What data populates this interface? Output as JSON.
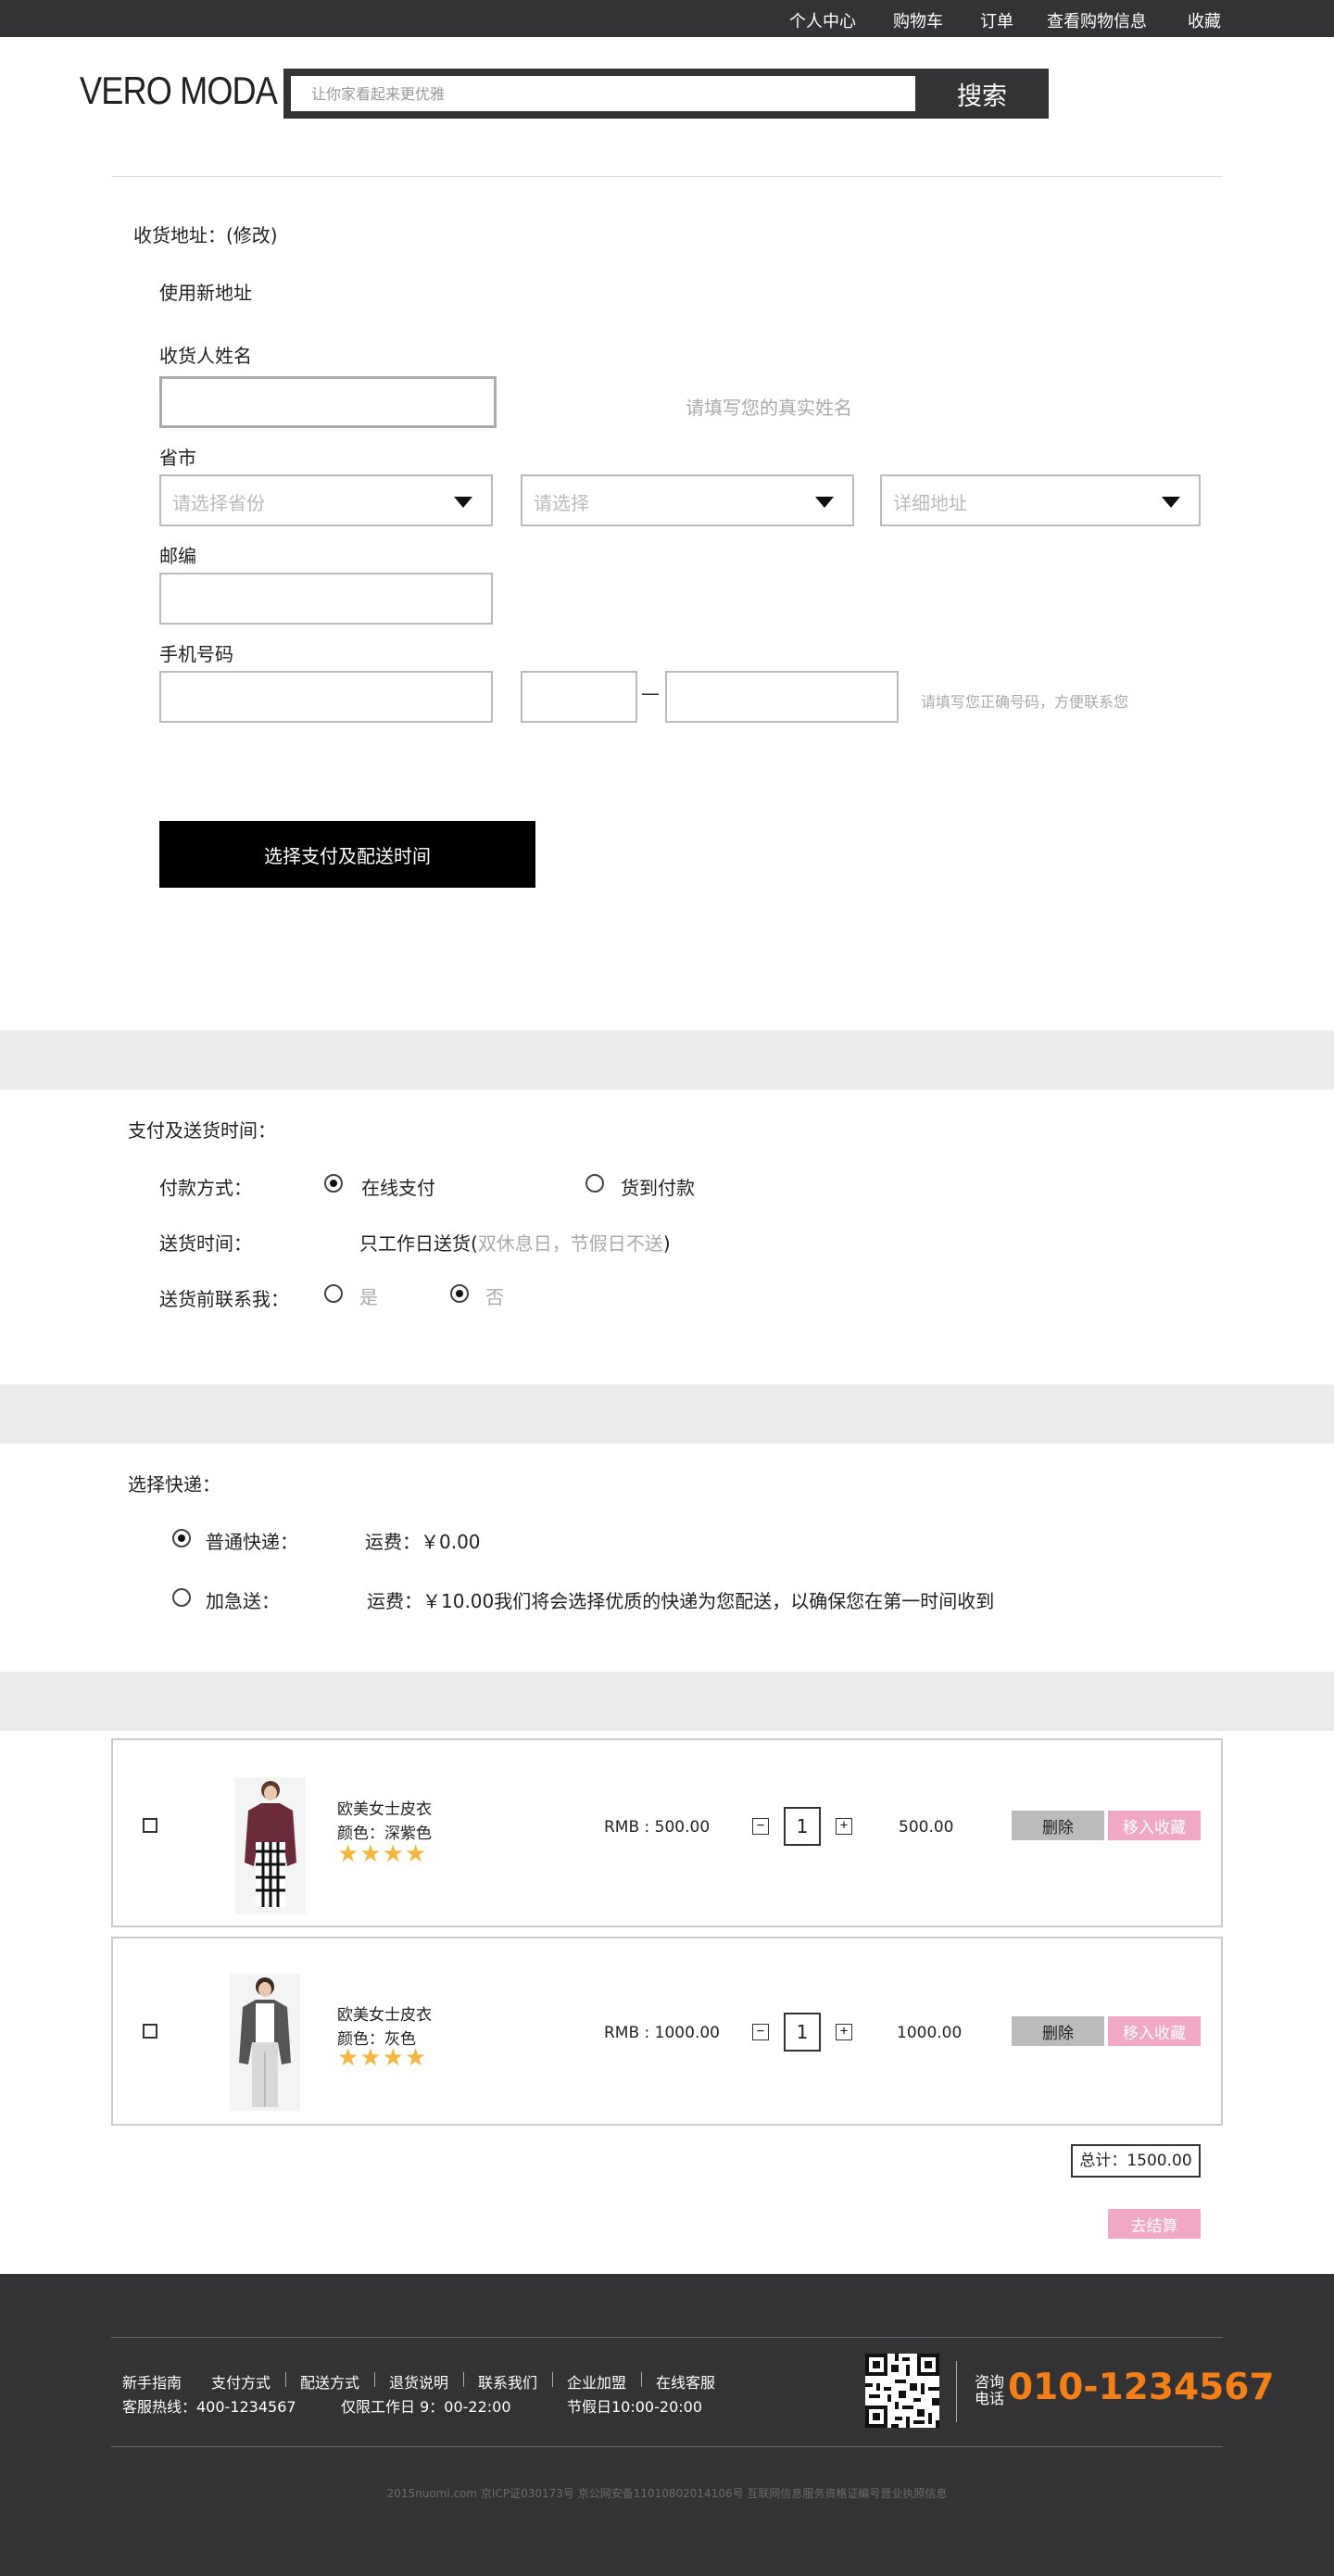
{
  "topnav": {
    "items": [
      "个人中心",
      "购物车",
      "订单",
      "查看购物信息",
      "收藏"
    ]
  },
  "header": {
    "logo": "VERO MODA",
    "search_placeholder": "让你家看起来更优雅",
    "search_button": "搜索"
  },
  "address": {
    "title": "收货地址：(修改)",
    "use_new": "使用新地址",
    "name_label": "收货人姓名",
    "name_hint": "请填写您的真实姓名",
    "province_label": "省市",
    "province_placeholder": "请选择省份",
    "city_placeholder": "请选择",
    "detail_placeholder": "详细地址",
    "zip_label": "邮编",
    "phone_label": "手机号码",
    "phone_dash": "—",
    "phone_hint": "请填写您正确号码，方便联系您",
    "submit": "选择支付及配送时间"
  },
  "payment": {
    "title": "支付及送货时间：",
    "method_label": "付款方式：",
    "online": "在线支付",
    "cod": "货到付款",
    "method_selected": "在线支付",
    "time_label": "送货时间：",
    "time_value": "只工作日送货",
    "time_paren_open": "(",
    "time_note": "双休息日，节假日不送",
    "time_paren_close": ")",
    "contact_label": "送货前联系我：",
    "yes": "是",
    "no": "否",
    "contact_selected": "否"
  },
  "shipping": {
    "title": "选择快递：",
    "options": [
      {
        "name": "普通快递：",
        "fee": "运费：￥0.00",
        "selected": true
      },
      {
        "name": "加急送：",
        "fee": "运费：￥10.00我们将会选择优质的快递为您配送，以确保您在第一时间收到",
        "selected": false
      }
    ]
  },
  "cart": {
    "items": [
      {
        "name": "欧美女士皮衣",
        "color": "颜色：深紫色",
        "stars": "★★★★",
        "rating": 4,
        "price": "RMB : 500.00",
        "qty": "1",
        "subtotal": "500.00",
        "delete": "删除",
        "favorite": "移入收藏",
        "jacket_color": "#6b2c3a"
      },
      {
        "name": "欧美女士皮衣",
        "color": "颜色：灰色",
        "stars": "★★★★",
        "rating": 4,
        "price": "RMB : 1000.00",
        "qty": "1",
        "subtotal": "1000.00",
        "delete": "删除",
        "favorite": "移入收藏",
        "jacket_color": "#555555"
      }
    ],
    "minus": "−",
    "plus": "+",
    "total": "总计：1500.00",
    "checkout": "去结算"
  },
  "footer": {
    "links": [
      "新手指南",
      "支付方式",
      "配送方式",
      "退货说明",
      "联系我们",
      "企业加盟",
      "在线客服"
    ],
    "hotline": "客服热线：400-1234567",
    "workday": "仅限工作日 9：00-22:00",
    "holiday": "节假日10:00-20:00",
    "consult": "咨询电话",
    "phone": "010-1234567",
    "copyright": "2015nuomi.com  京ICP证030173号   京公网安备11010802014106号  互联网信息服务资格证编号营业执照信息"
  },
  "colors": {
    "dark": "#333336",
    "accent_pink": "#f1a8c4",
    "star": "#f3b63f",
    "phone_orange": "#f57f17"
  }
}
